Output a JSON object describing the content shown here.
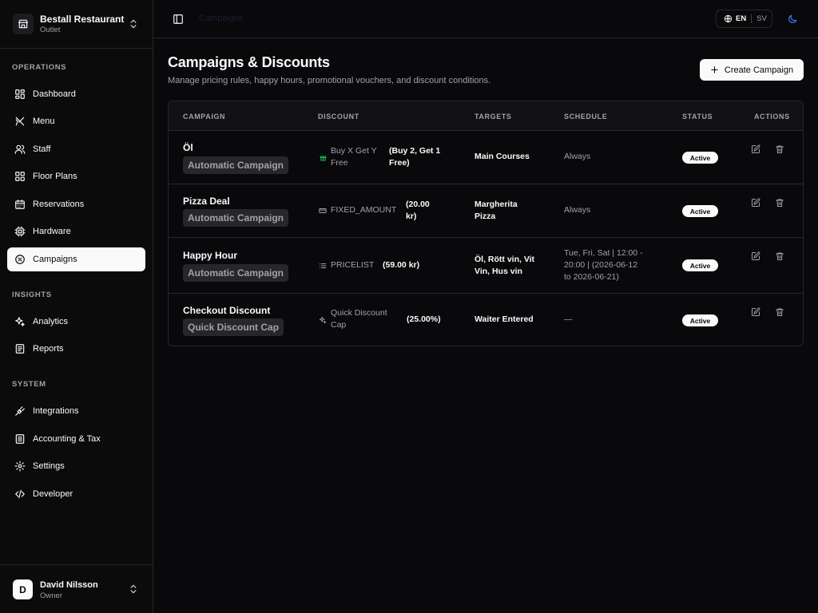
{
  "outlet": {
    "name": "Bestall Restaurant",
    "sub": "Outlet"
  },
  "sections": {
    "operations": "OPERATIONS",
    "insights": "INSIGHTS",
    "system": "SYSTEM"
  },
  "nav": {
    "dashboard": "Dashboard",
    "menu": "Menu",
    "staff": "Staff",
    "floor_plans": "Floor Plans",
    "reservations": "Reservations",
    "hardware": "Hardware",
    "campaigns": "Campaigns",
    "analytics": "Analytics",
    "reports": "Reports",
    "integrations": "Integrations",
    "accounting": "Accounting & Tax",
    "settings": "Settings",
    "developer": "Developer"
  },
  "user": {
    "initial": "D",
    "name": "David Nilsson",
    "role": "Owner"
  },
  "topbar": {
    "breadcrumb": "Campaigns",
    "lang_active": "EN",
    "lang_other": "SV"
  },
  "page": {
    "title": "Campaigns & Discounts",
    "subtitle": "Manage pricing rules, happy hours, promotional vouchers, and discount conditions.",
    "create_label": "Create Campaign"
  },
  "table": {
    "headers": {
      "campaign": "CAMPAIGN",
      "discount": "DISCOUNT",
      "targets": "TARGETS",
      "schedule": "SCHEDULE",
      "status": "STATUS",
      "actions": "ACTIONS"
    },
    "rows": [
      {
        "name": "Öl",
        "tag": "Automatic Campaign",
        "icon": "gift-icon",
        "icon_color": "#22c55e",
        "type_lines": [
          "Buy X Get Y",
          "Free"
        ],
        "value_lines": [
          "(Buy 2, Get 1",
          "Free)"
        ],
        "target_lines": [
          "Main Courses"
        ],
        "schedule_lines": [
          "Always"
        ],
        "status": "Active"
      },
      {
        "name": "Pizza Deal",
        "tag": "Automatic Campaign",
        "icon": "banknote-icon",
        "icon_color": "#a1a1aa",
        "type_lines": [
          "FIXED_AMOUNT"
        ],
        "value_lines": [
          "(20.00",
          "kr)"
        ],
        "target_lines": [
          "Margherita",
          "Pizza"
        ],
        "schedule_lines": [
          "Always"
        ],
        "status": "Active"
      },
      {
        "name": "Happy Hour",
        "tag": "Automatic Campaign",
        "icon": "list-icon",
        "icon_color": "#a1a1aa",
        "type_lines": [
          "PRICELIST"
        ],
        "value_lines": [
          "(59.00 kr)"
        ],
        "target_lines": [
          "Öl, Rött vin, Vit",
          "Vin, Hus vin"
        ],
        "schedule_lines": [
          "Tue, Fri, Sat | 12:00 -",
          "20:00 | (2026-06-12",
          "to 2026-06-21)"
        ],
        "status": "Active"
      },
      {
        "name": "Checkout Discount",
        "tag": "Quick Discount Cap",
        "icon": "sparkles-icon",
        "icon_color": "#a1a1aa",
        "type_lines": [
          "Quick Discount",
          "Cap"
        ],
        "value_lines": [
          "(25.00%)"
        ],
        "target_lines": [
          "Waiter Entered"
        ],
        "schedule_lines": [
          "—"
        ],
        "status": "Active"
      }
    ]
  }
}
